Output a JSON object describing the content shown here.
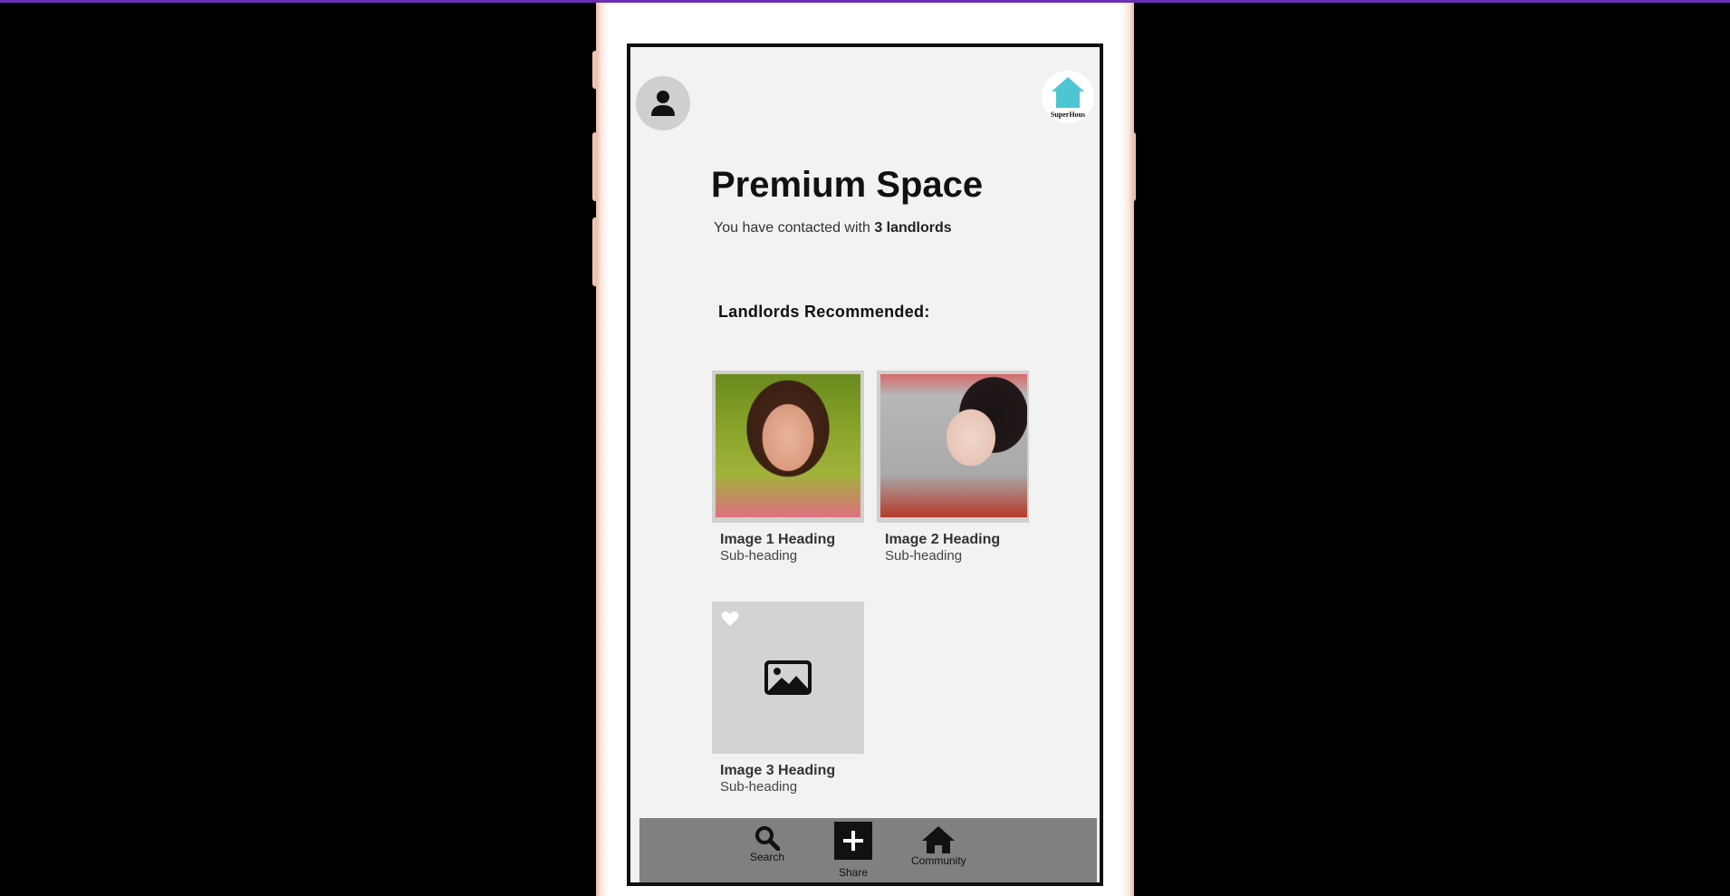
{
  "page": {
    "title": "Premium Space",
    "subtitle_prefix": "You have contacted with ",
    "subtitle_emphasis": "3 landlords"
  },
  "logo": {
    "text": "SuperHous"
  },
  "section": {
    "title": "Landlords Recommended:"
  },
  "cards": [
    {
      "heading": "Image 1 Heading",
      "subheading": "Sub-heading"
    },
    {
      "heading": "Image 2 Heading",
      "subheading": "Sub-heading"
    },
    {
      "heading": "Image 3 Heading",
      "subheading": "Sub-heading"
    }
  ],
  "nav": {
    "search_label": "Search",
    "share_label": "Share",
    "community_label": "Community"
  },
  "colors": {
    "accent_top_strip": "#6b2fb3",
    "logo_house": "#4ec6d2",
    "screen_bg": "#f2f2f2",
    "navbar_bg": "#808080"
  },
  "icons": [
    "user-icon",
    "house-logo-icon",
    "heart-icon",
    "image-placeholder-icon",
    "search-icon",
    "plus-icon",
    "home-icon"
  ]
}
